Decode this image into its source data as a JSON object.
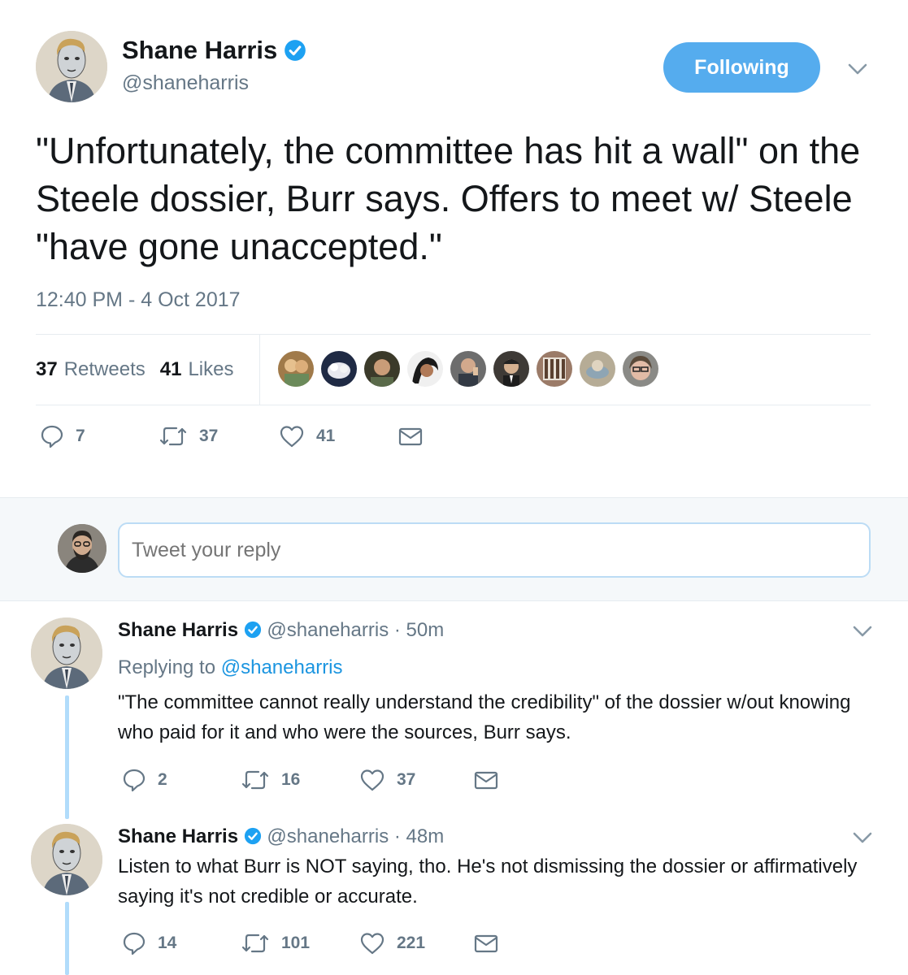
{
  "main_tweet": {
    "author_name": "Shane Harris",
    "author_handle": "@shaneharris",
    "follow_label": "Following",
    "text": "\"Unfortunately, the committee has hit a wall\" on the Steele dossier, Burr says. Offers to meet w/ Steele \"have gone unaccepted.\"",
    "timestamp": "12:40 PM - 4 Oct 2017",
    "retweets_count": "37",
    "retweets_label": "Retweets",
    "likes_count": "41",
    "likes_label": "Likes",
    "likers": [
      "liker-1",
      "liker-2",
      "liker-3",
      "liker-4",
      "liker-5",
      "liker-6",
      "liker-7",
      "liker-8",
      "liker-9"
    ],
    "actions": {
      "replies": "7",
      "retweets": "37",
      "likes": "41"
    }
  },
  "reply_box": {
    "placeholder": "Tweet your reply"
  },
  "thread": [
    {
      "author_name": "Shane Harris",
      "author_handle": "@shaneharris",
      "sep": "·",
      "time": "50m",
      "replying_prefix": "Replying to",
      "replying_to": "@shaneharris",
      "text": "\"The committee cannot really understand the credibility\" of the dossier w/out knowing who paid for it and who were the sources, Burr says.",
      "actions": {
        "replies": "2",
        "retweets": "16",
        "likes": "37"
      }
    },
    {
      "author_name": "Shane Harris",
      "author_handle": "@shaneharris",
      "sep": "·",
      "time": "48m",
      "text": "Listen to what Burr is NOT saying, tho. He's not dismissing the dossier or affirmatively saying it's not credible or accurate.",
      "actions": {
        "replies": "14",
        "retweets": "101",
        "likes": "221"
      }
    }
  ],
  "colors": {
    "accent": "#1b95e0",
    "follow_button": "#55acee",
    "secondary_text": "#657786",
    "primary_text": "#14171a",
    "thread_line": "#b1dcfb",
    "reply_bar_bg": "#f5f8fa"
  }
}
